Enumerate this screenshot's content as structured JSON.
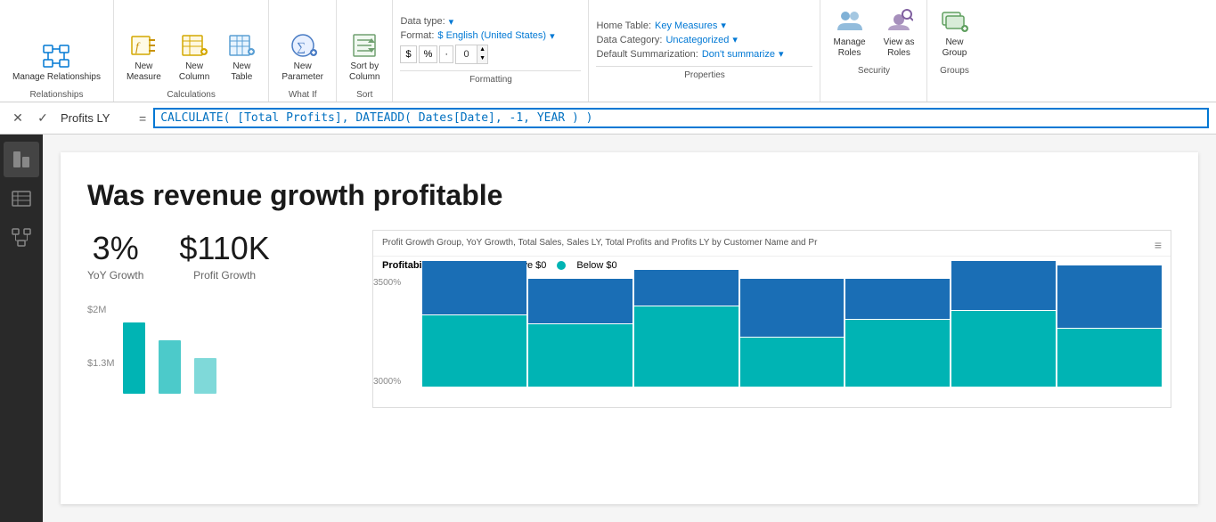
{
  "ribbon": {
    "groups": {
      "relationships": {
        "label": "Relationships",
        "items": [
          {
            "id": "manage-relationships",
            "label": "Manage\nRelationships",
            "icon": "⊞"
          }
        ]
      },
      "calculations": {
        "label": "Calculations",
        "items": [
          {
            "id": "new-measure",
            "label": "New\nMeasure",
            "icon": "𝑓"
          },
          {
            "id": "new-column",
            "label": "New\nColumn",
            "icon": "▦"
          },
          {
            "id": "new-table",
            "label": "New\nTable",
            "icon": "⊞"
          }
        ]
      },
      "whatif": {
        "label": "What If",
        "items": [
          {
            "id": "new-parameter",
            "label": "New\nParameter",
            "icon": "∑"
          }
        ]
      },
      "sort": {
        "label": "Sort",
        "items": [
          {
            "id": "sort-by-column",
            "label": "Sort by\nColumn",
            "icon": "↕"
          }
        ]
      }
    },
    "datatype": {
      "label": "Data type:",
      "value": "",
      "format_label": "Format:",
      "format_value": "$ English (United States)",
      "currency_symbol": "$",
      "percent_symbol": "%",
      "separator": "·",
      "decimal_places": "0",
      "default_summary_label": "Default Summarization:",
      "default_summary_value": "Don't summarize"
    },
    "properties": {
      "home_table_label": "Home Table:",
      "home_table_value": "Key Measures",
      "data_category_label": "Data Category:",
      "data_category_value": "Uncategorized",
      "default_summarization_label": "Default Summarization:",
      "default_summarization_value": "Don't summarize",
      "section_label": "Properties"
    },
    "security": {
      "label": "Security",
      "items": [
        {
          "id": "manage-roles",
          "label": "Manage\nRoles",
          "icon": "👤"
        },
        {
          "id": "view-as-roles",
          "label": "View as\nRoles",
          "icon": "🔍"
        }
      ]
    },
    "groups_section": {
      "label": "Groups",
      "items": [
        {
          "id": "new-group",
          "label": "New\nGroup",
          "icon": "G"
        }
      ]
    }
  },
  "formula_bar": {
    "cancel_label": "✕",
    "confirm_label": "✓",
    "measure_name": "Profits LY",
    "equals": "=",
    "formula": "CALCULATE( [Total Profits], DATEADD( Dates[Date], -1, YEAR ) )"
  },
  "left_nav": {
    "items": [
      {
        "id": "report-view",
        "icon": "📊",
        "label": "Report View"
      },
      {
        "id": "data-view",
        "icon": "⊞",
        "label": "Data View"
      },
      {
        "id": "model-view",
        "icon": "⬡",
        "label": "Model View"
      }
    ]
  },
  "canvas": {
    "title": "Was revenue growth profitable",
    "kpis": [
      {
        "value": "3%",
        "label": "YoY Growth"
      },
      {
        "value": "$110K",
        "label": "Profit Growth"
      }
    ],
    "bar_chart": {
      "label1": "$2M",
      "label2": "$1.3M"
    },
    "chart_panel": {
      "header": "Profit Growth Group, YoY Growth, Total Sales, Sales LY, Total Profits and Profits LY by Customer Name and Pr",
      "drag_icon": "≡",
      "legend_title": "Profitability Change",
      "legend_items": [
        {
          "label": "Above $0",
          "color": "#1a6eb5"
        },
        {
          "label": "Below $0",
          "color": "#00b4b4"
        }
      ],
      "y_labels": [
        "3500%",
        "3000%"
      ],
      "bars": [
        {
          "teal": 80,
          "blue": 60
        },
        {
          "teal": 70,
          "blue": 50
        },
        {
          "teal": 90,
          "blue": 40
        },
        {
          "teal": 55,
          "blue": 65
        },
        {
          "teal": 75,
          "blue": 45
        },
        {
          "teal": 85,
          "blue": 55
        },
        {
          "teal": 65,
          "blue": 70
        }
      ]
    }
  }
}
